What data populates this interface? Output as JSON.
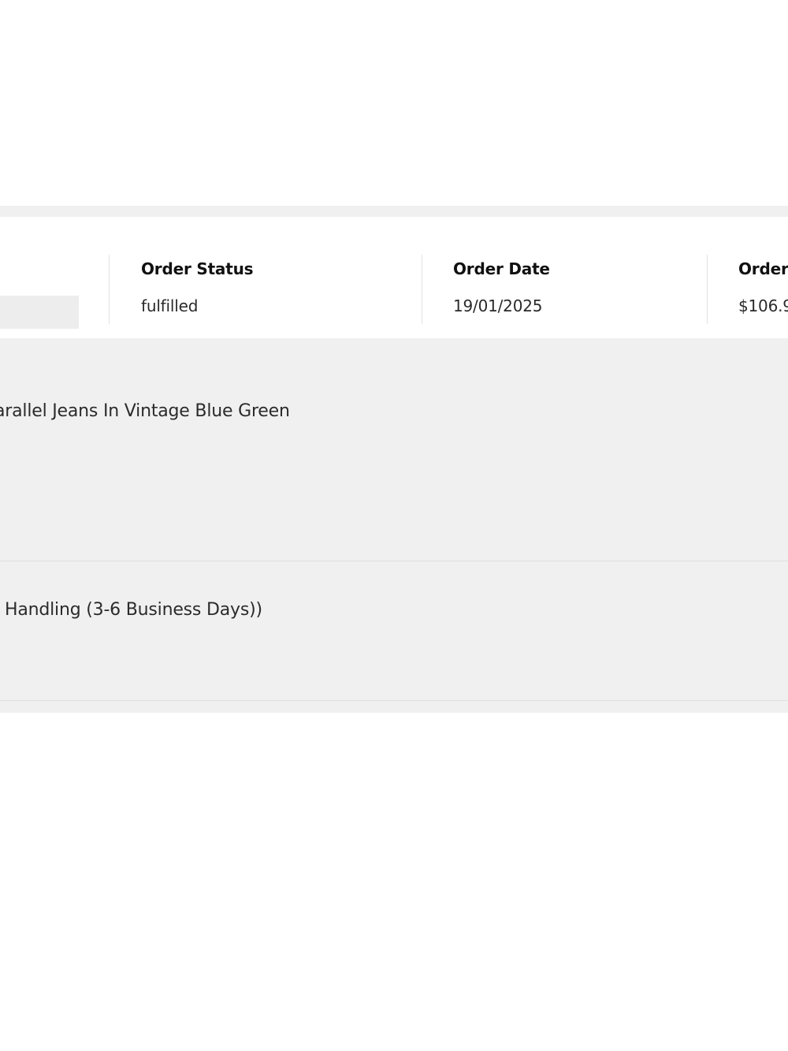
{
  "order_summary": {
    "status": {
      "label": "Order Status",
      "value": "fulfilled"
    },
    "date": {
      "label": "Order Date",
      "value": "19/01/2025"
    },
    "total": {
      "label": "Order",
      "value": "$106.9"
    }
  },
  "line_items": [
    {
      "title": "arallel Jeans In Vintage Blue Green"
    },
    {
      "title": ": Handling (3-6 Business Days))"
    }
  ]
}
